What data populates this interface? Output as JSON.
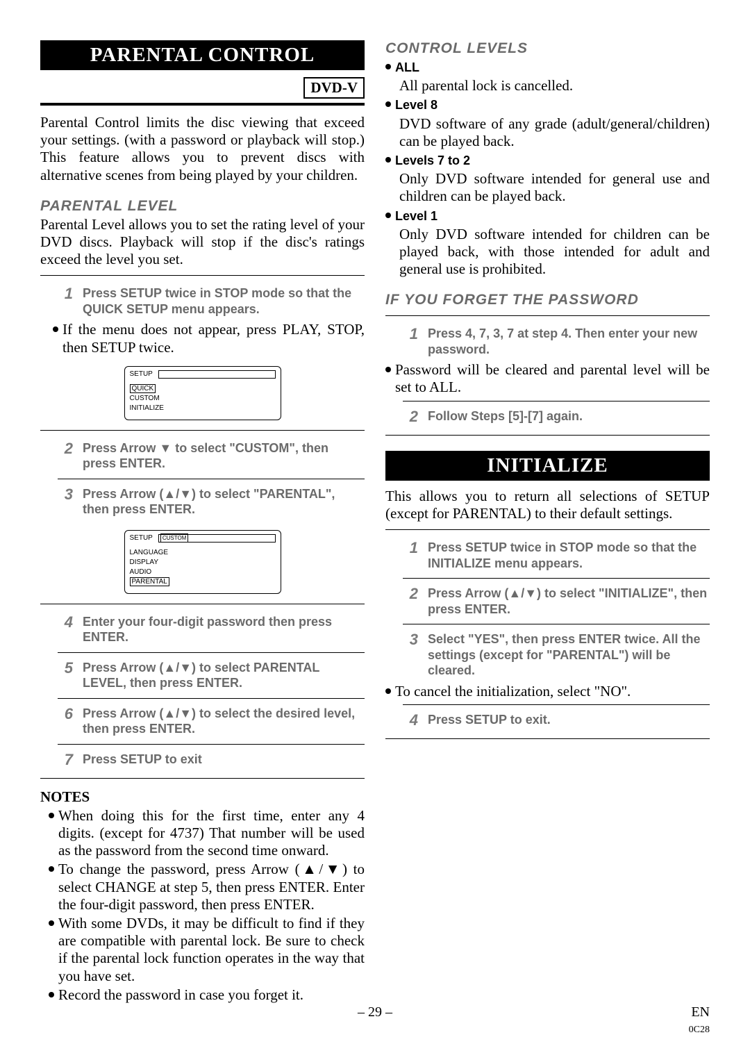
{
  "left": {
    "banner": "PARENTAL CONTROL",
    "badge": "DVD-V",
    "intro": "Parental Control limits the disc viewing that exceed your settings. (with a password or playback will stop.) This feature allows you to prevent discs with alternative scenes from being played by your children.",
    "subhead": "PARENTAL LEVEL",
    "subhead_text": "Parental Level allows you to set the rating level of your DVD discs. Playback will stop if the disc's ratings exceed the level you set.",
    "step1": "Press SETUP twice in STOP mode so that the QUICK SETUP menu appears.",
    "after1": "If the menu does not appear, press PLAY, STOP, then SETUP twice.",
    "menu1": {
      "title": "SETUP",
      "items": [
        "QUICK",
        "CUSTOM",
        "INITIALIZE"
      ]
    },
    "step2": "Press Arrow ▼ to select \"CUSTOM\", then press ENTER.",
    "step3": "Press Arrow (▲/▼) to select \"PARENTAL\", then press ENTER.",
    "menu2": {
      "title": "SETUP",
      "head_value": "CUSTOM",
      "items": [
        "LANGUAGE",
        "DISPLAY",
        "AUDIO",
        "PARENTAL"
      ]
    },
    "step4": "Enter your four-digit password then press ENTER.",
    "step5": "Press Arrow (▲/▼) to select PARENTAL LEVEL, then press ENTER.",
    "step6": "Press Arrow (▲/▼) to select the desired level, then press ENTER.",
    "step7": "Press SETUP to exit",
    "notes_head": "NOTES",
    "note1": "When doing this for the first time, enter any 4 digits. (except for 4737) That number will be used as the password from the second time onward.",
    "note2": "To change the password, press Arrow (▲/▼) to select CHANGE at step 5, then press ENTER. Enter the four-digit password, then press ENTER.",
    "note3": "With some DVDs, it may be difficult to find if they are compatible with parental lock. Be sure to check if the parental lock function operates in the way that you have set.",
    "note4": "Record the password in case you forget it."
  },
  "right": {
    "subhead1": "CONTROL LEVELS",
    "lvl_all_label": "ALL",
    "lvl_all_text": "All parental lock is cancelled.",
    "lvl8_label": "Level 8",
    "lvl8_text": "DVD software of any grade (adult/general/children) can be played back.",
    "lvl72_label": "Levels 7 to 2",
    "lvl72_text": "Only DVD software intended for general use and children can be played back.",
    "lvl1_label": "Level 1",
    "lvl1_text": "Only DVD software intended for children can be played back, with those intended for adult and general use is prohibited.",
    "subhead2": "IF YOU FORGET THE PASSWORD",
    "fp_step1": "Press 4, 7, 3, 7 at step 4. Then enter your new password.",
    "fp_after1": "Password will be cleared and parental level will be set to ALL.",
    "fp_step2": "Follow Steps [5]-[7] again.",
    "banner2": "INITIALIZE",
    "init_intro": "This allows you to return all selections of SETUP (except for PARENTAL) to their default settings.",
    "init_step1": "Press SETUP twice in STOP mode so that the INITIALIZE menu appears.",
    "init_step2": "Press Arrow (▲/▼) to select \"INITIALIZE\", then press ENTER.",
    "init_step3": "Select \"YES\", then press ENTER twice. All the settings (except for \"PARENTAL\") will be cleared.",
    "init_cancel": "To cancel the initialization, select \"NO\".",
    "init_step4": "Press SETUP to exit."
  },
  "footer": {
    "page": "– 29 –",
    "lang": "EN",
    "code": "0C28"
  },
  "nums": {
    "n1": "1",
    "n2": "2",
    "n3": "3",
    "n4": "4",
    "n5": "5",
    "n6": "6",
    "n7": "7"
  }
}
